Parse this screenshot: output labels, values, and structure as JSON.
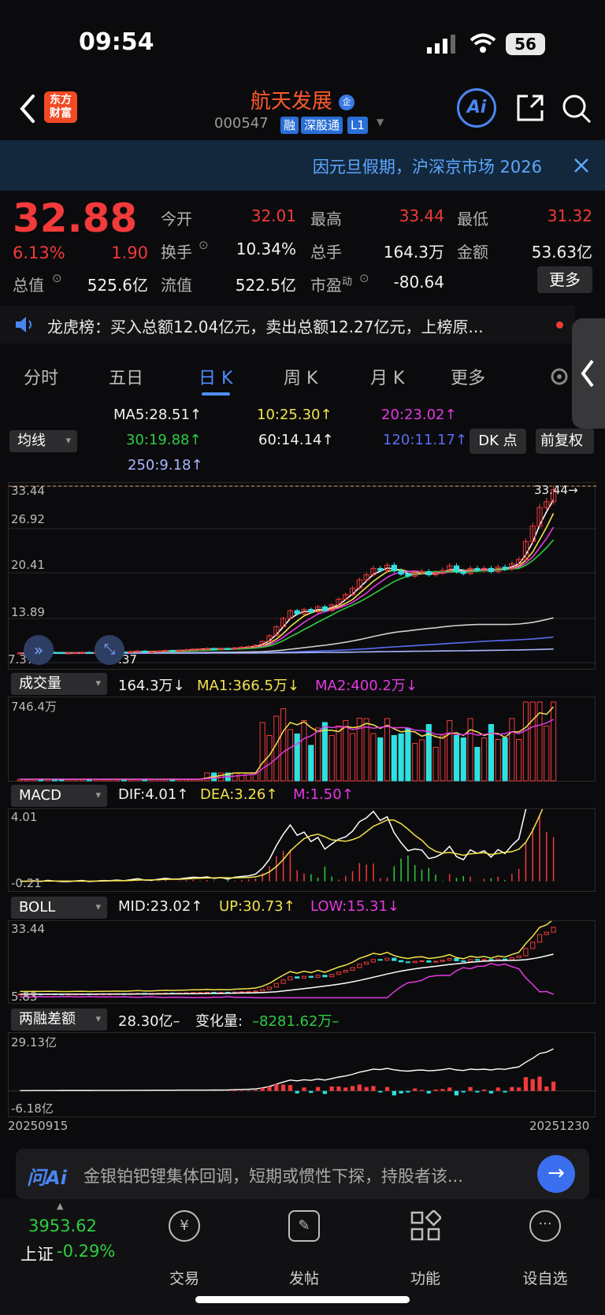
{
  "status": {
    "time": "09:54",
    "battery": "56"
  },
  "header": {
    "logo_line1": "东方",
    "logo_line2": "财富",
    "stock_name": "航天发展",
    "badge": "企",
    "code": "000547",
    "tags": [
      "融",
      "深股通",
      "L1"
    ],
    "ai_label": "Ai"
  },
  "notice": {
    "text": "因元旦假期，沪深京市场 2026"
  },
  "quote": {
    "price": "32.88",
    "change_pct": "6.13%",
    "change": "1.90",
    "fields": [
      {
        "label": "今开",
        "value": "32.01"
      },
      {
        "label": "最高",
        "value": "33.44"
      },
      {
        "label": "最低",
        "value": "31.32"
      },
      {
        "label": "换手",
        "value": "10.34%"
      },
      {
        "label": "总手",
        "value": "164.3万"
      },
      {
        "label": "金额",
        "value": "53.63亿"
      },
      {
        "label": "总值",
        "value": "525.6亿"
      },
      {
        "label": "流值",
        "value": "522.5亿"
      },
      {
        "label": "市盈",
        "value": "-80.64"
      }
    ],
    "pe_suffix": "动",
    "more_label": "更多"
  },
  "lhb": {
    "text": "龙虎榜：买入总额12.04亿元，卖出总额12.27亿元，上榜原..."
  },
  "tabs": [
    {
      "label": "分时"
    },
    {
      "label": "五日"
    },
    {
      "label": "日 K"
    },
    {
      "label": "周 K"
    },
    {
      "label": "月 K"
    },
    {
      "label": "更多"
    }
  ],
  "ma": {
    "selector": "均线",
    "ma5": "MA5:28.51",
    "ma10": "10:25.30",
    "ma20": "20:23.02",
    "ma30": "30:19.88",
    "ma60": "60:14.14",
    "ma120": "120:11.17",
    "ma250": "250:9.18",
    "dk_label": "DK 点",
    "fq_label": "前复权",
    "arrow": "↑"
  },
  "kline": {
    "ticks": [
      "33.44",
      "26.92",
      "20.41",
      "13.89",
      "7.37"
    ],
    "high_label": "33.44",
    "low_label": "7.37"
  },
  "volume": {
    "selector": "成交量",
    "v": "164.3万",
    "ma1": "MA1:366.5万",
    "ma2": "MA2:400.2万",
    "top": "746.4万",
    "down": "↓"
  },
  "macd": {
    "selector": "MACD",
    "dif": "DIF:4.01",
    "dea": "DEA:3.26",
    "m": "M:1.50",
    "top": "4.01",
    "bottom": "-0.21"
  },
  "boll": {
    "selector": "BOLL",
    "mid": "MID:23.02",
    "up": "UP:30.73",
    "low": "LOW:15.31",
    "top": "33.44",
    "bottom": "5.83"
  },
  "margin": {
    "selector": "两融差额",
    "value": "28.30亿–",
    "change_label": "变化量:",
    "change": "–8281.62万–",
    "top": "29.13亿",
    "bottom": "-6.18亿"
  },
  "dates": {
    "start": "20250915",
    "end": "20251230"
  },
  "ask": {
    "label": "问Ai",
    "text": "金银铂钯锂集体回调，短期或惯性下探，持股者该..."
  },
  "nav": {
    "index_value": "3953.62",
    "index_name": "上证",
    "index_change": "-0.29%",
    "items": [
      "交易",
      "发帖",
      "功能",
      "设自选"
    ]
  },
  "chart_data": {
    "type": "candlestick",
    "start_date": "20250915",
    "end_date": "20251230",
    "price_range": [
      7.37,
      33.44
    ],
    "last_close": 32.88,
    "closes_approx": [
      7.4,
      7.4,
      7.45,
      7.4,
      7.5,
      7.45,
      7.4,
      7.4,
      7.45,
      7.5,
      7.4,
      7.45,
      7.5,
      7.5,
      7.55,
      7.5,
      7.6,
      7.7,
      7.6,
      7.6,
      7.7,
      7.8,
      7.75,
      7.8,
      7.9,
      8.0,
      8.0,
      8.1,
      8.0,
      8.1,
      8.0,
      8.2,
      8.3,
      8.4,
      8.6,
      9.2,
      10.1,
      11.5,
      12.8,
      14.0,
      13.5,
      14.2,
      13.8,
      14.6,
      14.0,
      14.9,
      15.8,
      16.5,
      17.5,
      18.8,
      19.6,
      20.6,
      20.3,
      21.1,
      20.2,
      19.7,
      19.4,
      19.9,
      20.1,
      19.6,
      19.9,
      20.3,
      21.0,
      20.1,
      19.8,
      20.6,
      20.3,
      20.6,
      20.1,
      20.8,
      20.5,
      21.3,
      22.0,
      24.8,
      27.2,
      30.1,
      31.0,
      32.88
    ]
  }
}
